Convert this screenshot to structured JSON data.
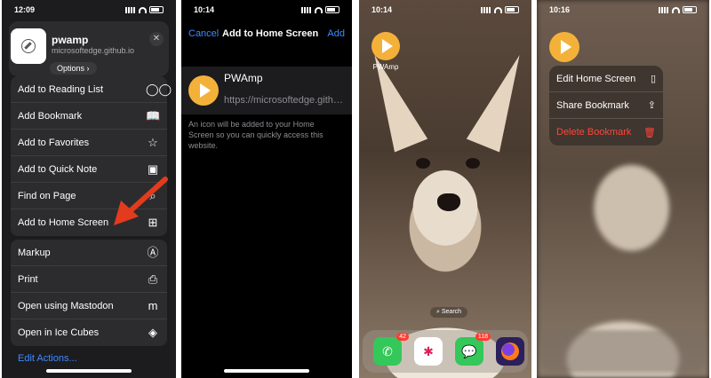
{
  "panel1": {
    "time": "12:09",
    "site_name": "pwamp",
    "site_url": "microsoftedge.github.io",
    "options_label": "Options",
    "group1": [
      {
        "label": "Add to Reading List",
        "icon": "◯◯"
      },
      {
        "label": "Add Bookmark",
        "icon": "📖"
      },
      {
        "label": "Add to Favorites",
        "icon": "☆"
      },
      {
        "label": "Add to Quick Note",
        "icon": "▣"
      },
      {
        "label": "Find on Page",
        "icon": "⌕"
      },
      {
        "label": "Add to Home Screen",
        "icon": "⊞"
      }
    ],
    "group2": [
      {
        "label": "Markup",
        "icon": "Ⓐ"
      },
      {
        "label": "Print",
        "icon": "⎙"
      },
      {
        "label": "Open using Mastodon",
        "icon": "m"
      },
      {
        "label": "Open in Ice Cubes",
        "icon": "◈"
      }
    ],
    "edit_actions": "Edit Actions..."
  },
  "panel2": {
    "time": "10:14",
    "cancel": "Cancel",
    "title": "Add to Home Screen",
    "add": "Add",
    "app_name": "PWAmp",
    "url": "https://microsoftedge.github.io",
    "note": "An icon will be added to your Home Screen so you can quickly access this website."
  },
  "panel3": {
    "time": "10:14",
    "app_label": "PWAmp",
    "search": "Search",
    "dock": [
      {
        "name": "Phone",
        "badge": "42",
        "color": "#34c759"
      },
      {
        "name": "Slack",
        "badge": "",
        "color": "#ffffff"
      },
      {
        "name": "Messages",
        "badge": "118",
        "color": "#34c759"
      },
      {
        "name": "Firefox",
        "badge": "",
        "color": "#2b1f5c"
      }
    ]
  },
  "panel4": {
    "time": "10:16",
    "menu": [
      {
        "label": "Edit Home Screen",
        "icon": "▯"
      },
      {
        "label": "Share Bookmark",
        "icon": "⇪"
      },
      {
        "label": "Delete Bookmark",
        "icon": "🗑"
      }
    ]
  },
  "colors": {
    "accent_blue": "#3d8bff",
    "arrow_red": "#e23b1d",
    "play_orange": "#f4b13a",
    "delete_red": "#ff453a"
  }
}
